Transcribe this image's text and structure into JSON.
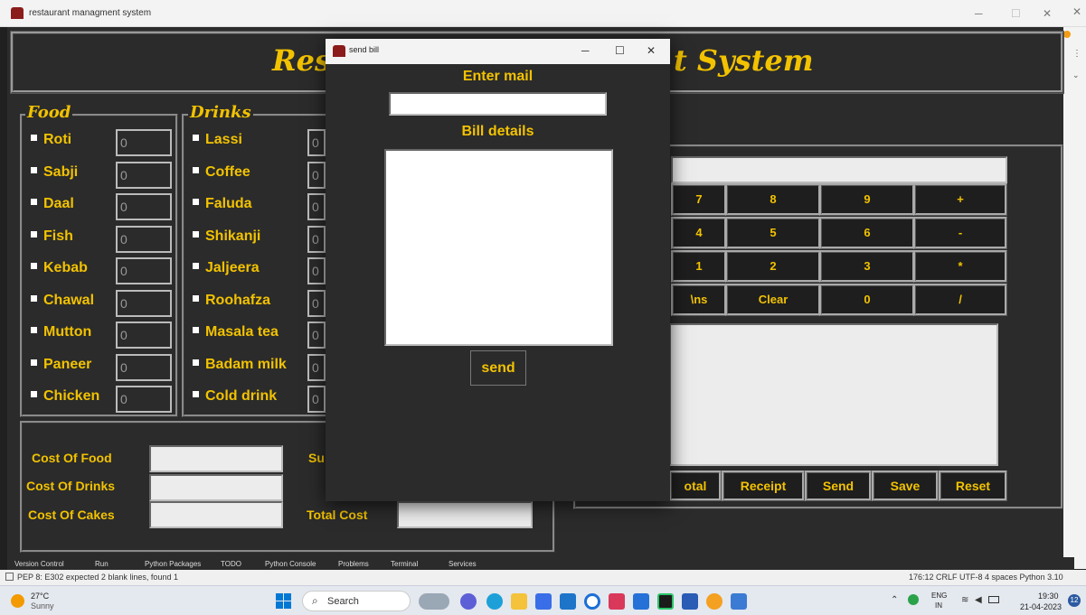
{
  "window": {
    "title": "restaurant managment system"
  },
  "app": {
    "heading_left": "Res",
    "heading_right": "t System"
  },
  "food": {
    "label": "Food",
    "items": [
      {
        "name": "Roti",
        "qty": "0"
      },
      {
        "name": "Sabji",
        "qty": "0"
      },
      {
        "name": "Daal",
        "qty": "0"
      },
      {
        "name": "Fish",
        "qty": "0"
      },
      {
        "name": "Kebab",
        "qty": "0"
      },
      {
        "name": "Chawal",
        "qty": "0"
      },
      {
        "name": "Mutton",
        "qty": "0"
      },
      {
        "name": "Paneer",
        "qty": "0"
      },
      {
        "name": "Chicken",
        "qty": "0"
      }
    ]
  },
  "drinks": {
    "label": "Drinks",
    "items": [
      {
        "name": "Lassi",
        "qty": "0"
      },
      {
        "name": "Coffee",
        "qty": "0"
      },
      {
        "name": "Faluda",
        "qty": "0"
      },
      {
        "name": "Shikanji",
        "qty": "0"
      },
      {
        "name": "Jaljeera",
        "qty": "0"
      },
      {
        "name": "Roohafza",
        "qty": "0"
      },
      {
        "name": "Masala tea",
        "qty": "0"
      },
      {
        "name": "Badam milk",
        "qty": "0"
      },
      {
        "name": "Cold drink",
        "qty": "0"
      }
    ]
  },
  "costs": {
    "food": "Cost Of Food",
    "drinks": "Cost Of Drinks",
    "cakes": "Cost Of Cakes",
    "sub": "Su",
    "total": "Total Cost"
  },
  "calc": {
    "rows": [
      [
        "7",
        "8",
        "9",
        "+"
      ],
      [
        "4",
        "5",
        "6",
        "-"
      ],
      [
        "1",
        "2",
        "3",
        "*"
      ],
      [
        "\\ns",
        "Clear",
        "0",
        "/"
      ]
    ]
  },
  "bill_buttons": [
    "otal",
    "Receipt",
    "Send",
    "Save",
    "Reset"
  ],
  "dialog": {
    "title": "send bill",
    "mail_label": "Enter mail",
    "mail_value": "",
    "bill_label": "Bill details",
    "send": "send"
  },
  "ide": {
    "tabs": [
      "Version Control",
      "Run",
      "Python Packages",
      "TODO",
      "Python Console",
      "Problems",
      "Terminal",
      "Services"
    ],
    "status_left": "PEP 8: E302 expected 2 blank lines, found 1",
    "status_right": "176:12  CRLF  UTF-8  4 spaces  Python 3.10"
  },
  "taskbar": {
    "temp": "27°C",
    "weather": "Sunny",
    "search": "Search",
    "lang1": "ENG",
    "lang2": "IN",
    "time": "19:30",
    "date": "21-04-2023",
    "badge": "12"
  },
  "colors": {
    "accent": "#f2c200",
    "bg": "#2b2b2b"
  }
}
